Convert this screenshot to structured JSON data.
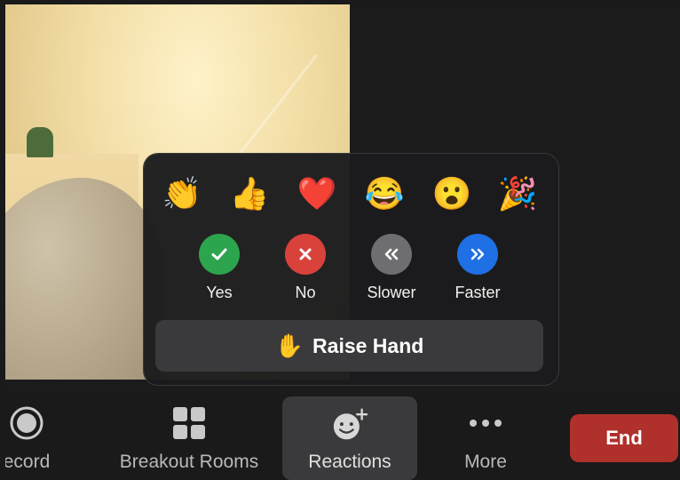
{
  "reactions_popup": {
    "emojis": [
      {
        "name": "clapping-hands",
        "char": "👏"
      },
      {
        "name": "thumbs-up",
        "char": "👍"
      },
      {
        "name": "heart",
        "char": "❤️"
      },
      {
        "name": "tears-of-joy",
        "char": "😂"
      },
      {
        "name": "open-mouth",
        "char": "😮"
      },
      {
        "name": "party-popper",
        "char": "🎉"
      }
    ],
    "feedback": [
      {
        "label": "Yes",
        "color": "#2da44e",
        "icon": "check-icon"
      },
      {
        "label": "No",
        "color": "#d9413b",
        "icon": "x-icon"
      },
      {
        "label": "Slower",
        "color": "#6e6e70",
        "icon": "double-chevron-left-icon"
      },
      {
        "label": "Faster",
        "color": "#1f6fe5",
        "icon": "double-chevron-right-icon"
      }
    ],
    "raise_hand": {
      "label": "Raise Hand",
      "icon": "✋"
    }
  },
  "toolbar": {
    "record_label": "ecord",
    "breakout_label": "Breakout Rooms",
    "reactions_label": "Reactions",
    "more_label": "More",
    "end_label": "End"
  },
  "colors": {
    "end": "#b0302c",
    "toolbar_bg": "#1a1a1a",
    "popup_bg": "#1c1c1e"
  }
}
